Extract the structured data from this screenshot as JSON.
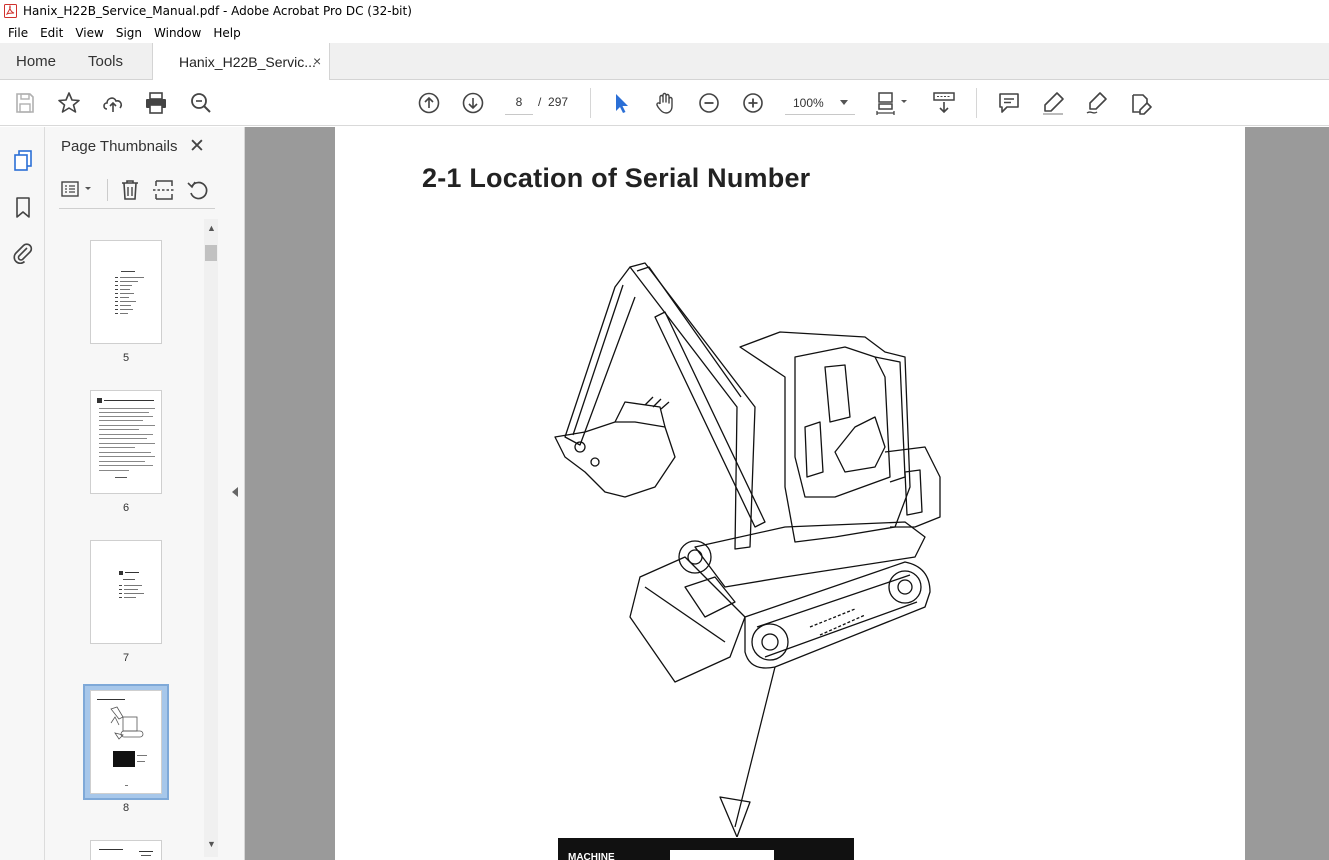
{
  "window": {
    "title": "Hanix_H22B_Service_Manual.pdf - Adobe Acrobat Pro DC (32-bit)"
  },
  "menu": [
    "File",
    "Edit",
    "View",
    "Sign",
    "Window",
    "Help"
  ],
  "tabs": {
    "home": "Home",
    "tools": "Tools",
    "document": "Hanix_H22B_Servic...",
    "close_glyph": "×"
  },
  "toolbar": {
    "current_page": "8",
    "page_separator": "/",
    "total_pages": "297",
    "zoom": "100%",
    "accent_color": "#2b6fd6"
  },
  "sidebar": {
    "panel_title": "Page Thumbnails",
    "close_glyph": "✕",
    "thumbnails": [
      {
        "page": "5",
        "selected": false
      },
      {
        "page": "6",
        "selected": false
      },
      {
        "page": "7",
        "selected": false
      },
      {
        "page": "8",
        "selected": true
      }
    ]
  },
  "document": {
    "heading": "2-1  Location of Serial Number",
    "plate_text": "MACHINE"
  }
}
